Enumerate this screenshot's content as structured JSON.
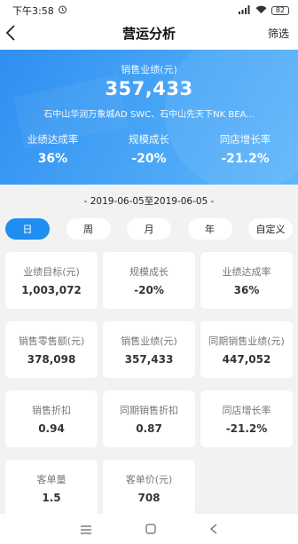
{
  "status": {
    "time": "下午3:58",
    "battery": "82"
  },
  "nav": {
    "title": "营运分析",
    "filter": "筛选"
  },
  "hero": {
    "label": "销售业绩(元)",
    "value": "357,433",
    "stores": "石中山华润万象城AD SWC、石中山先天下NK BEA...",
    "metrics": [
      {
        "label": "业绩达成率",
        "value": "36%"
      },
      {
        "label": "规模成长",
        "value": "-20%"
      },
      {
        "label": "同店增长率",
        "value": "-21.2%"
      }
    ]
  },
  "date_range": "- 2019-06-05至2019-06-05 -",
  "tabs": [
    {
      "label": "日"
    },
    {
      "label": "周"
    },
    {
      "label": "月"
    },
    {
      "label": "年"
    },
    {
      "label": "自定义"
    }
  ],
  "cards": [
    {
      "label": "业绩目标(元)",
      "value": "1,003,072"
    },
    {
      "label": "规模成长",
      "value": "-20%"
    },
    {
      "label": "业绩达成率",
      "value": "36%"
    },
    {
      "label": "销售零售额(元)",
      "value": "378,098"
    },
    {
      "label": "销售业绩(元)",
      "value": "357,433"
    },
    {
      "label": "同期销售业绩(元)",
      "value": "447,052"
    },
    {
      "label": "销售折扣",
      "value": "0.94"
    },
    {
      "label": "同期销售折扣",
      "value": "0.87"
    },
    {
      "label": "同店增长率",
      "value": "-21.2%"
    },
    {
      "label": "客单量",
      "value": "1.5"
    },
    {
      "label": "客单价(元)",
      "value": "708"
    }
  ],
  "colors": {
    "accent": "#1f8ef1",
    "hero": "#3d9cf4",
    "background": "#f2f2f2"
  },
  "icons": {
    "back": "back-arrow-icon",
    "signal": "signal-icon",
    "wifi": "wifi-icon",
    "alarm": "alarm-icon"
  }
}
